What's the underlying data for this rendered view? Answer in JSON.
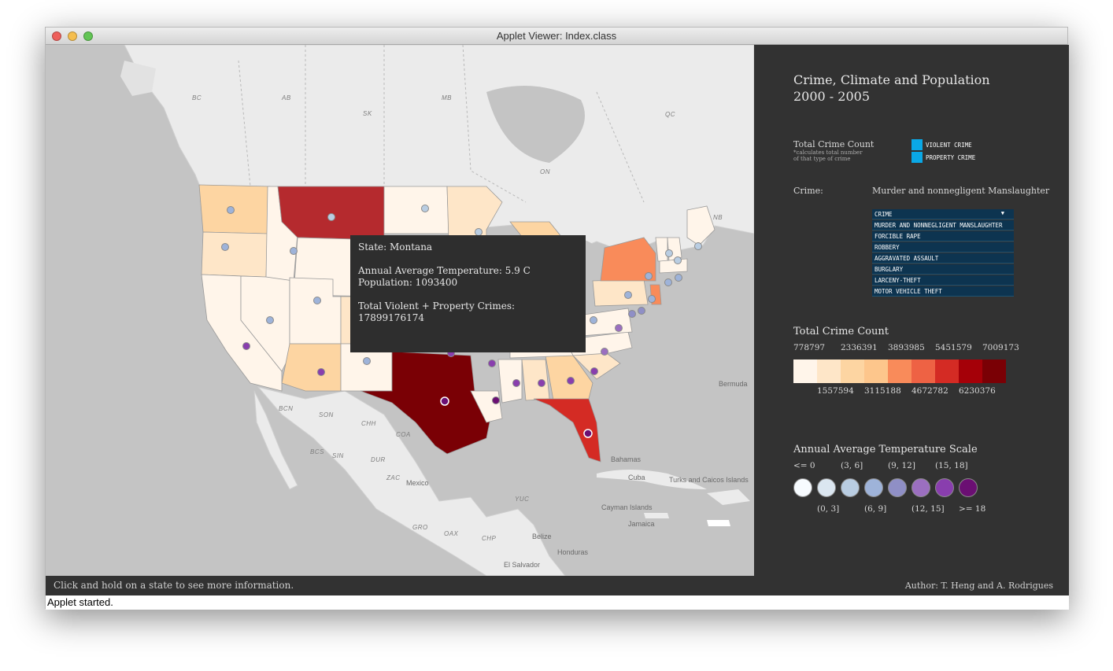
{
  "window": {
    "title": "Applet Viewer: Index.class"
  },
  "map": {
    "labels": [
      "BC",
      "AB",
      "SK",
      "MB",
      "ON",
      "QC",
      "NB",
      "Bermuda",
      "BCN",
      "SON",
      "CHH",
      "COA",
      "DUR",
      "ZAC",
      "Mexico",
      "YUC",
      "Bahamas",
      "Cuba",
      "Turks and Caicos Islands",
      "Cayman Islands",
      "Jamaica",
      "Belize",
      "Honduras",
      "El Salvador",
      "OAX",
      "CHP",
      "GRO",
      "BCS",
      "SIN"
    ],
    "tooltip": {
      "state": "State: Montana",
      "temperature": "Annual Average Temperature: 5.9 C",
      "population": "Population: 1093400",
      "crimes_label": "Total Violent + Property Crimes:",
      "crimes_value": "17899176174"
    }
  },
  "panel": {
    "title_line1": "Crime, Climate and Population",
    "title_line2": "2000 - 2005",
    "total_count_label": "Total Crime Count",
    "total_count_note1": "*calculates total number",
    "total_count_note2": "of that type of crime",
    "crime_type_options": [
      "VIOLENT CRIME",
      "PROPERTY CRIME"
    ],
    "crime_label": "Crime:",
    "crime_selected": "Murder and nonnegligent Manslaughter",
    "dropdown": {
      "header": "CRIME",
      "items": [
        "MURDER AND NONNEGLIGENT MANSLAUGHTER",
        "FORCIBLE RAPE",
        "ROBBERY",
        "AGGRAVATED ASSAULT",
        "BURGLARY",
        "LARCENY-THEFT",
        "MOTOR VEHICLE THEFT"
      ]
    },
    "crime_scale": {
      "title": "Total Crime Count",
      "top_labels": [
        "778797",
        "2336391",
        "3893985",
        "5451579",
        "7009173"
      ],
      "bottom_labels": [
        "1557594",
        "3115188",
        "4672782",
        "6230376"
      ],
      "colors": [
        "#fff5ea",
        "#fee6c8",
        "#fdd5a2",
        "#fdc68c",
        "#f98b5a",
        "#ee6244",
        "#d42b24",
        "#a50008",
        "#7a0005"
      ]
    },
    "temp_scale": {
      "title": "Annual Average Temperature Scale",
      "top_labels": [
        "<= 0",
        "(3, 6]",
        "(9, 12]",
        "(15, 18]"
      ],
      "bottom_labels": [
        "(0, 3]",
        "(6, 9]",
        "(12, 15]",
        ">= 18"
      ],
      "colors": [
        "#f7fbff",
        "#dbe6f0",
        "#b9cde2",
        "#9eb3d9",
        "#8f8fc6",
        "#9b6fc0",
        "#893eae",
        "#6b0f73"
      ]
    },
    "author": "Author: T. Heng and A. Rodrigues"
  },
  "status": {
    "hint": "Click and hold on a state to see more information.",
    "applet": "Applet started."
  }
}
